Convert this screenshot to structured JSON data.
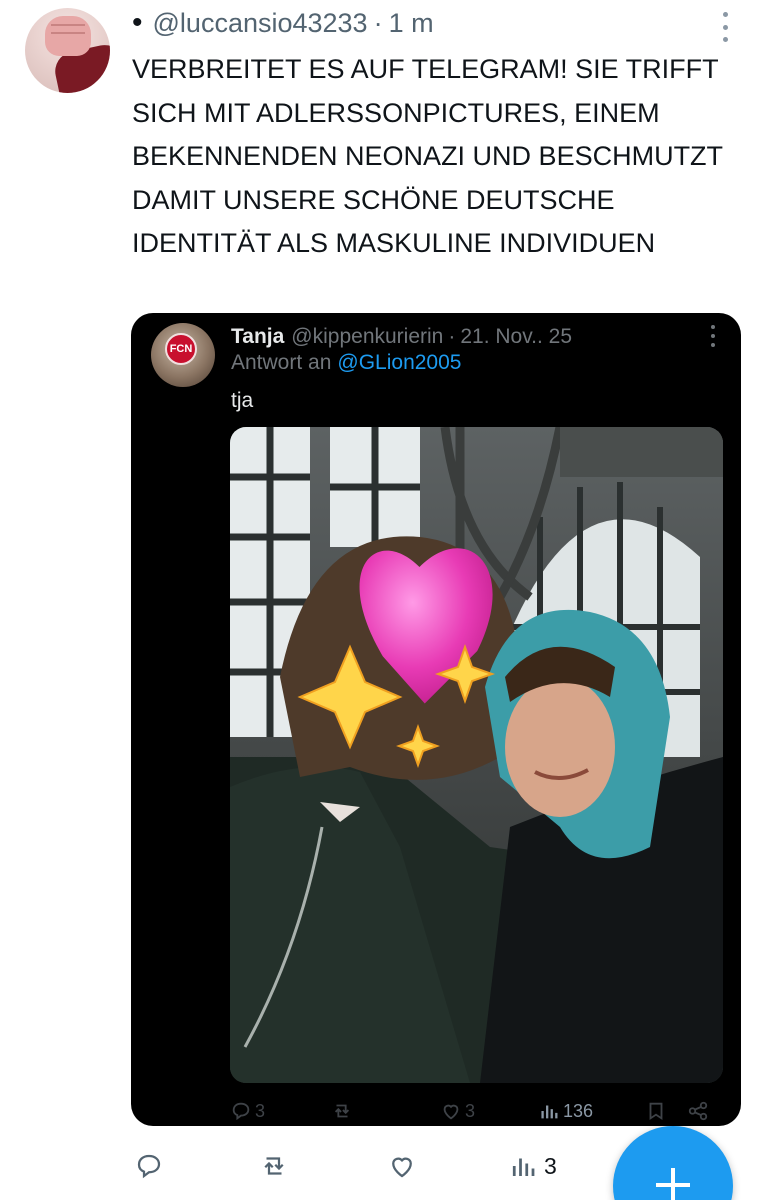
{
  "post": {
    "bullet": "•",
    "handle": "@luccansio43233",
    "separator": "·",
    "time": "1 m",
    "text": "VERBREITET ES AUF TELEGRAM! SIE TRIFFT SICH MIT ADLERSSONPICTURES, EINEM BEKENNENDEN NEONAZI UND BESCHMUTZT DAMIT UNSERE SCHÖNE DEUTSCHE IDENTITÄT ALS MASKULINE INDIVIDUEN",
    "views": "3",
    "avatar_icon": "raised-fist-avatar",
    "more_icon": "vertical-dots-icon"
  },
  "quote": {
    "name": "Tanja",
    "handle": "@kippenkurierin",
    "separator": "·",
    "date": "21. Nov.. 25",
    "reply_prefix": "Antwort an",
    "reply_mention": "@GLion2005",
    "text": "tja",
    "avatar_badge": "FCN",
    "stats": {
      "replies": "3",
      "likes": "3",
      "views": "136"
    },
    "photo_description_icon": "selfie-photo"
  },
  "colors": {
    "accent": "#1d9bf0",
    "text": "#0f1419",
    "muted": "#536471",
    "card_bg": "#000000"
  },
  "icons": {
    "reply": "comment-icon",
    "retweet": "retweet-icon",
    "like": "heart-icon",
    "views": "bar-chart-icon",
    "bookmark": "bookmark-icon",
    "share": "share-icon",
    "compose": "plus-icon"
  }
}
